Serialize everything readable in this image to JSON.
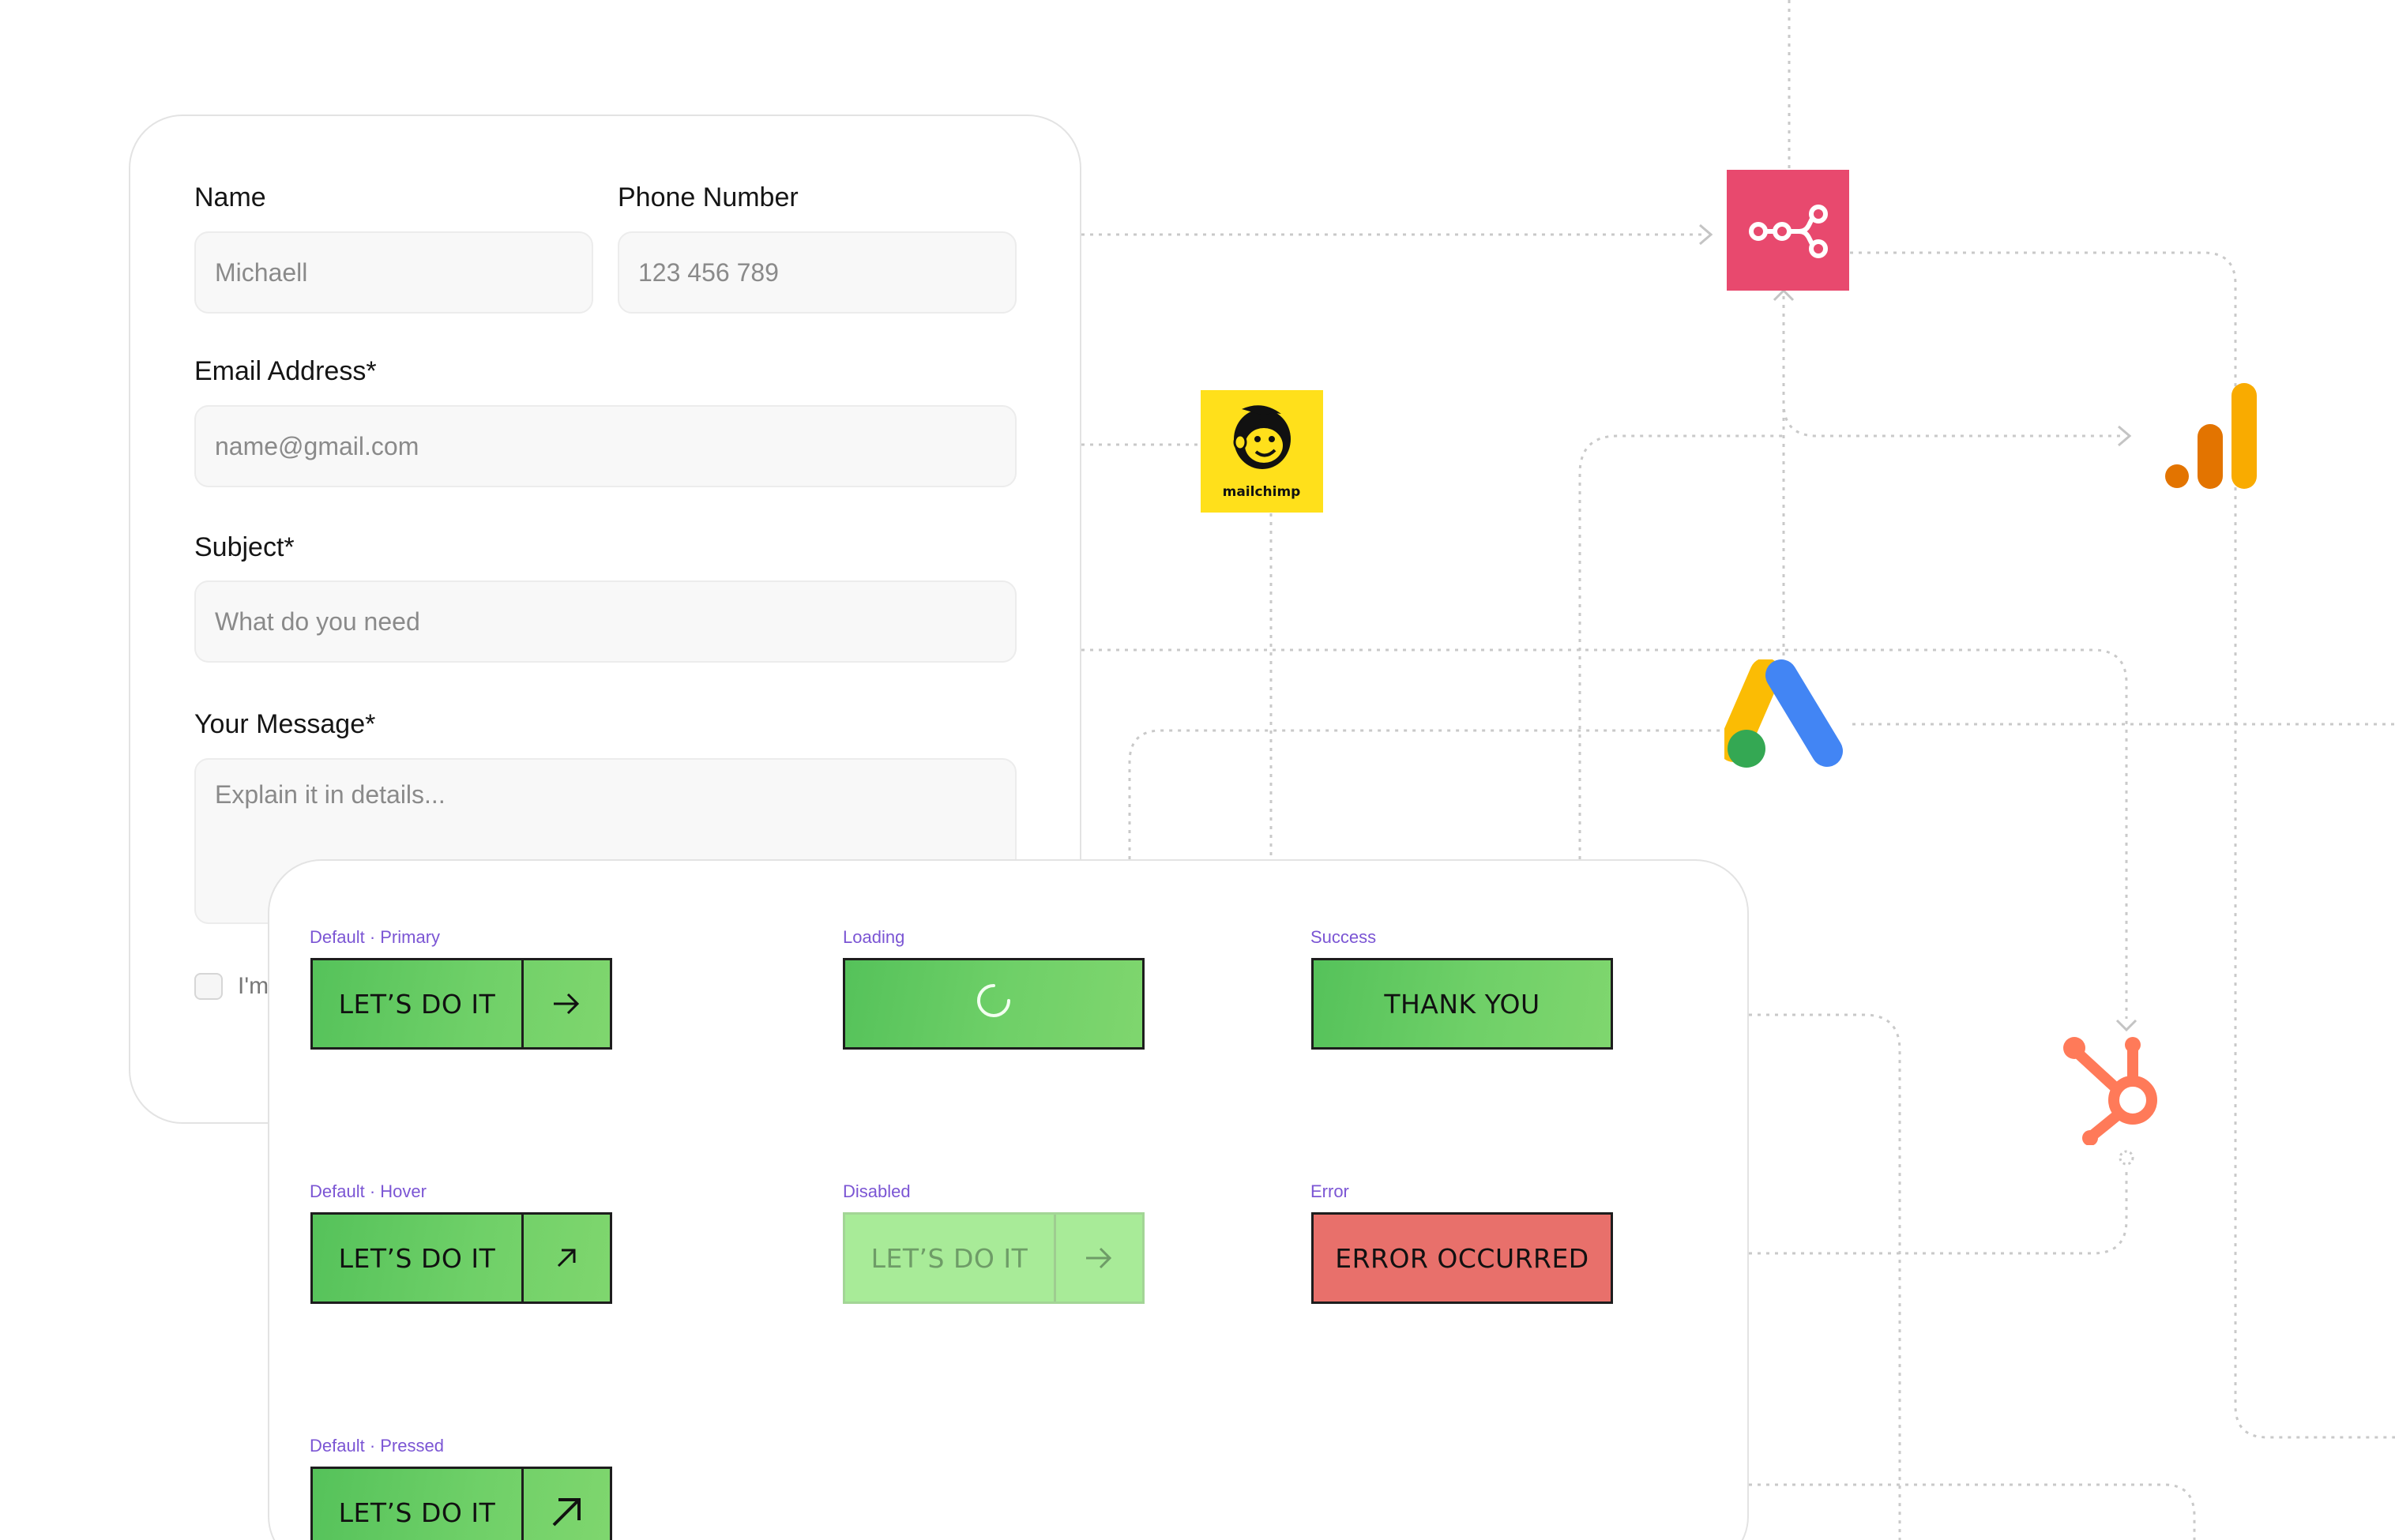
{
  "form": {
    "name_label": "Name",
    "name_placeholder": "Michaell",
    "phone_label": "Phone Number",
    "phone_placeholder": "123 456 789",
    "email_label": "Email Address*",
    "email_placeholder": "name@gmail.com",
    "subject_label": "Subject*",
    "subject_placeholder": "What do you need",
    "message_label": "Your Message*",
    "message_placeholder": "Explain it in details...",
    "checkbox_text": "I'm"
  },
  "button_states": {
    "default_primary": {
      "label": "Default · Primary",
      "text": "LET’S DO IT",
      "arrow": "arrow-right-icon"
    },
    "loading": {
      "label": "Loading",
      "icon": "spinner-icon"
    },
    "success": {
      "label": "Success",
      "text": "THANK YOU"
    },
    "default_hover": {
      "label": "Default · Hover",
      "text": "LET’S DO IT",
      "arrow": "arrow-up-right-icon"
    },
    "disabled": {
      "label": "Disabled",
      "text": "LET’S DO IT",
      "arrow": "arrow-right-icon"
    },
    "error": {
      "label": "Error",
      "text": "ERROR OCCURRED"
    },
    "default_pressed": {
      "label": "Default · Pressed",
      "text": "LET’S DO IT",
      "arrow": "arrow-up-right-icon"
    }
  },
  "integrations": {
    "mailchimp": {
      "name": "mailchimp",
      "icon": "mailchimp-logo",
      "color": "#ffe01b"
    },
    "webhook": {
      "icon": "webhook-logo",
      "color": "#e8496e"
    },
    "google_analytics": {
      "icon": "google-analytics-logo",
      "colors": [
        "#e37400",
        "#f9ab00"
      ]
    },
    "google_ads": {
      "icon": "google-ads-logo",
      "colors": [
        "#fbbc04",
        "#4285f4",
        "#34a853"
      ]
    },
    "hubspot": {
      "icon": "hubspot-logo",
      "color": "#ff7a59"
    }
  },
  "colors": {
    "button_green": "#5fc75f",
    "button_disabled": "#a8eb98",
    "button_error": "#e8706b",
    "state_label": "#7b55d4"
  }
}
